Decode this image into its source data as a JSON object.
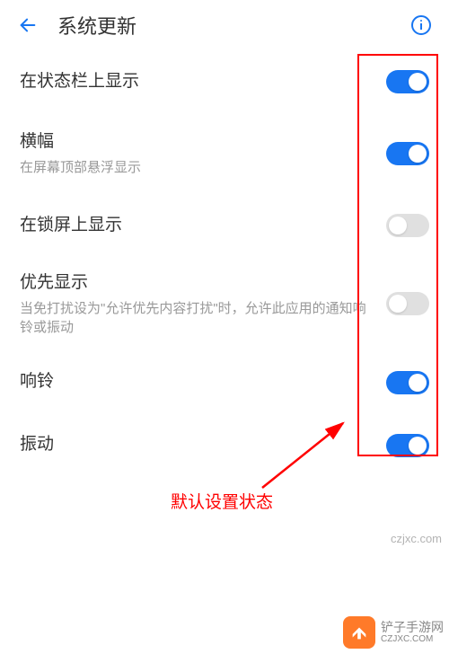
{
  "header": {
    "title": "系统更新"
  },
  "settings": [
    {
      "title": "在状态栏上显示",
      "desc": "",
      "enabled": true
    },
    {
      "title": "横幅",
      "desc": "在屏幕顶部悬浮显示",
      "enabled": true
    },
    {
      "title": "在锁屏上显示",
      "desc": "",
      "enabled": false
    },
    {
      "title": "优先显示",
      "desc": "当免打扰设为\"允许优先内容打扰\"时，允许此应用的通知响铃或振动",
      "enabled": false
    },
    {
      "title": "响铃",
      "desc": "",
      "enabled": true
    },
    {
      "title": "振动",
      "desc": "",
      "enabled": true
    }
  ],
  "annotation": {
    "label": "默认设置状态"
  },
  "watermark": "czjxc.com",
  "logo": {
    "line1": "铲子手游网",
    "line2": "CZJXC.COM"
  }
}
